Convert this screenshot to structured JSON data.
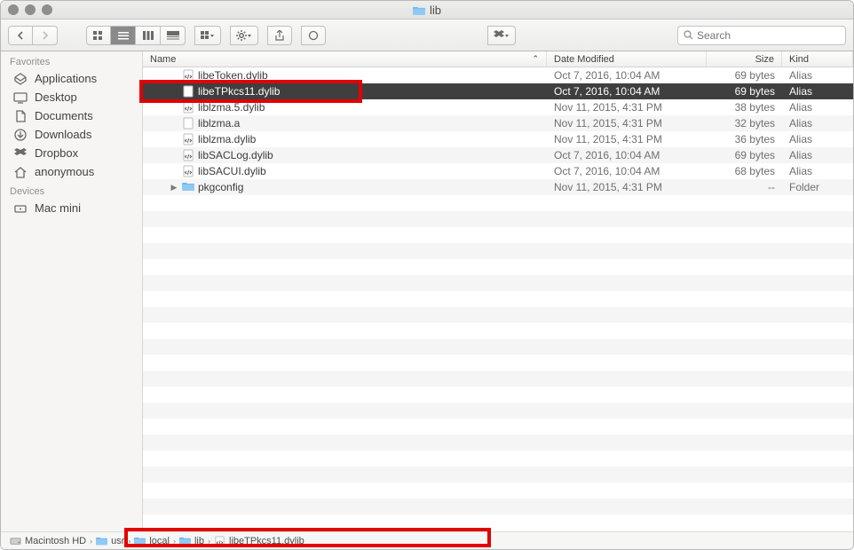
{
  "window": {
    "title": "lib"
  },
  "search": {
    "placeholder": "Search"
  },
  "sidebar": {
    "sections": [
      {
        "label": "Favorites",
        "items": [
          {
            "label": "Applications",
            "icon": "applications"
          },
          {
            "label": "Desktop",
            "icon": "desktop"
          },
          {
            "label": "Documents",
            "icon": "documents"
          },
          {
            "label": "Downloads",
            "icon": "downloads"
          },
          {
            "label": "Dropbox",
            "icon": "dropbox"
          },
          {
            "label": "anonymous",
            "icon": "home"
          }
        ]
      },
      {
        "label": "Devices",
        "items": [
          {
            "label": "Mac mini",
            "icon": "computer"
          }
        ]
      }
    ]
  },
  "columns": {
    "name": "Name",
    "date": "Date Modified",
    "size": "Size",
    "kind": "Kind"
  },
  "files": [
    {
      "name": "libeToken.dylib",
      "date": "Oct 7, 2016, 10:04 AM",
      "size": "69 bytes",
      "kind": "Alias",
      "icon": "exec",
      "selected": false,
      "expandable": false
    },
    {
      "name": "libeTPkcs11.dylib",
      "date": "Oct 7, 2016, 10:04 AM",
      "size": "69 bytes",
      "kind": "Alias",
      "icon": "exec",
      "selected": true,
      "expandable": false
    },
    {
      "name": "liblzma.5.dylib",
      "date": "Nov 11, 2015, 4:31 PM",
      "size": "38 bytes",
      "kind": "Alias",
      "icon": "exec",
      "selected": false,
      "expandable": false
    },
    {
      "name": "liblzma.a",
      "date": "Nov 11, 2015, 4:31 PM",
      "size": "32 bytes",
      "kind": "Alias",
      "icon": "doc",
      "selected": false,
      "expandable": false
    },
    {
      "name": "liblzma.dylib",
      "date": "Nov 11, 2015, 4:31 PM",
      "size": "36 bytes",
      "kind": "Alias",
      "icon": "exec",
      "selected": false,
      "expandable": false
    },
    {
      "name": "libSACLog.dylib",
      "date": "Oct 7, 2016, 10:04 AM",
      "size": "69 bytes",
      "kind": "Alias",
      "icon": "exec",
      "selected": false,
      "expandable": false
    },
    {
      "name": "libSACUI.dylib",
      "date": "Oct 7, 2016, 10:04 AM",
      "size": "68 bytes",
      "kind": "Alias",
      "icon": "exec",
      "selected": false,
      "expandable": false
    },
    {
      "name": "pkgconfig",
      "date": "Nov 11, 2015, 4:31 PM",
      "size": "--",
      "kind": "Folder",
      "icon": "folder",
      "selected": false,
      "expandable": true
    }
  ],
  "path": [
    {
      "label": "Macintosh HD",
      "icon": "disk"
    },
    {
      "label": "usr",
      "icon": "folder"
    },
    {
      "label": "local",
      "icon": "folder"
    },
    {
      "label": "lib",
      "icon": "folder"
    },
    {
      "label": "libeTPkcs11.dylib",
      "icon": "exec"
    }
  ]
}
